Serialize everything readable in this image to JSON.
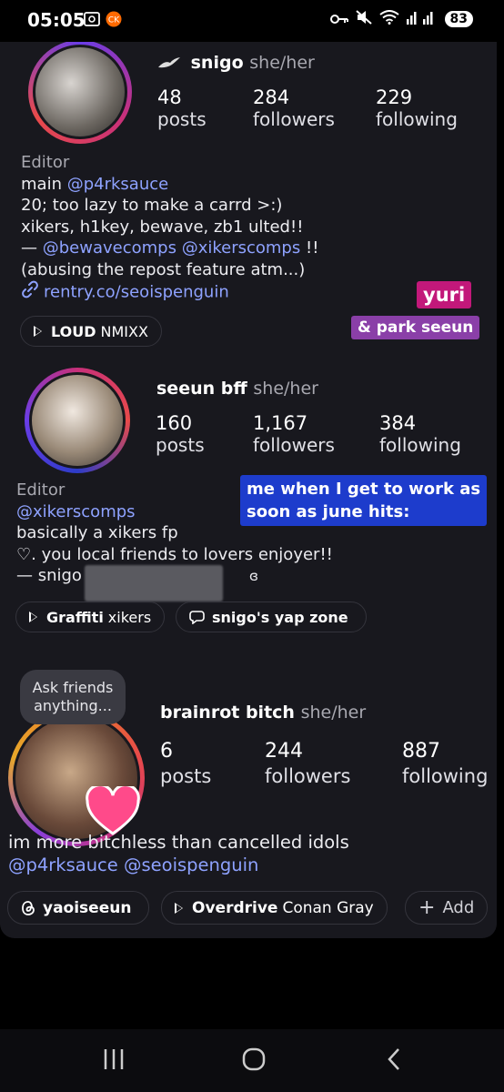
{
  "status": {
    "time": "05:05",
    "battery": "83"
  },
  "profiles": [
    {
      "name": "snigo",
      "pronouns": "she/her",
      "stats": [
        {
          "num": "48",
          "label": "posts"
        },
        {
          "num": "284",
          "label": "followers"
        },
        {
          "num": "229",
          "label": "following"
        }
      ],
      "category": "Editor",
      "bio": {
        "line1_prefix": "main ",
        "line1_mention": "@p4rksauce",
        "line2": "20; too lazy to make a carrd >:)",
        "line3": "xikers, h1key, bewave, zb1 ulted!!",
        "line4_prefix": "— ",
        "line4_m1": "@bewavecomps",
        "line4_m2": "@xikerscomps",
        "line4_suffix": " !!",
        "line5": "(abusing the repost feature atm...)",
        "link": "rentry.co/seoispenguin"
      },
      "chip_music": {
        "title": "LOUD",
        "artist": "NMIXX"
      },
      "stickers": [
        "yuri",
        "& park seeun"
      ]
    },
    {
      "name": "seeun bff",
      "pronouns": "she/her",
      "stats": [
        {
          "num": "160",
          "label": "posts"
        },
        {
          "num": "1,167",
          "label": "followers"
        },
        {
          "num": "384",
          "label": "following"
        }
      ],
      "category": "Editor",
      "bio": {
        "mention": "@xikerscomps",
        "line2": "basically a xikers fp",
        "line3": "♡. you local friends to lovers enjoyer!!",
        "line4": "— snigo",
        "line4_end": "ɞ"
      },
      "sticker": [
        "me when I get to work as",
        "soon as june hits:"
      ],
      "chip_music": {
        "title": "Graffiti",
        "artist": "xikers"
      },
      "chip_zone": "snigo's yap zone"
    },
    {
      "name": "brainrot bitch",
      "pronouns": "she/her",
      "note": "Ask friends anything...",
      "stats": [
        {
          "num": "6",
          "label": "posts"
        },
        {
          "num": "244",
          "label": "followers"
        },
        {
          "num": "887",
          "label": "following"
        }
      ],
      "bio": {
        "line1": "im more bitchless than cancelled idols",
        "m1": "@p4rksauce",
        "m2": "@seoispenguin"
      },
      "chip_threads": "yaoiseeun",
      "chip_music": {
        "title": "Overdrive",
        "artist": "Conan Gray"
      },
      "chip_add": "Add"
    }
  ],
  "colors": {
    "accent_link": "#8ea2ff",
    "sticker_pink": "#c2187a",
    "sticker_purple": "#8a3fa8",
    "sticker_blue": "#1d3ccc"
  }
}
